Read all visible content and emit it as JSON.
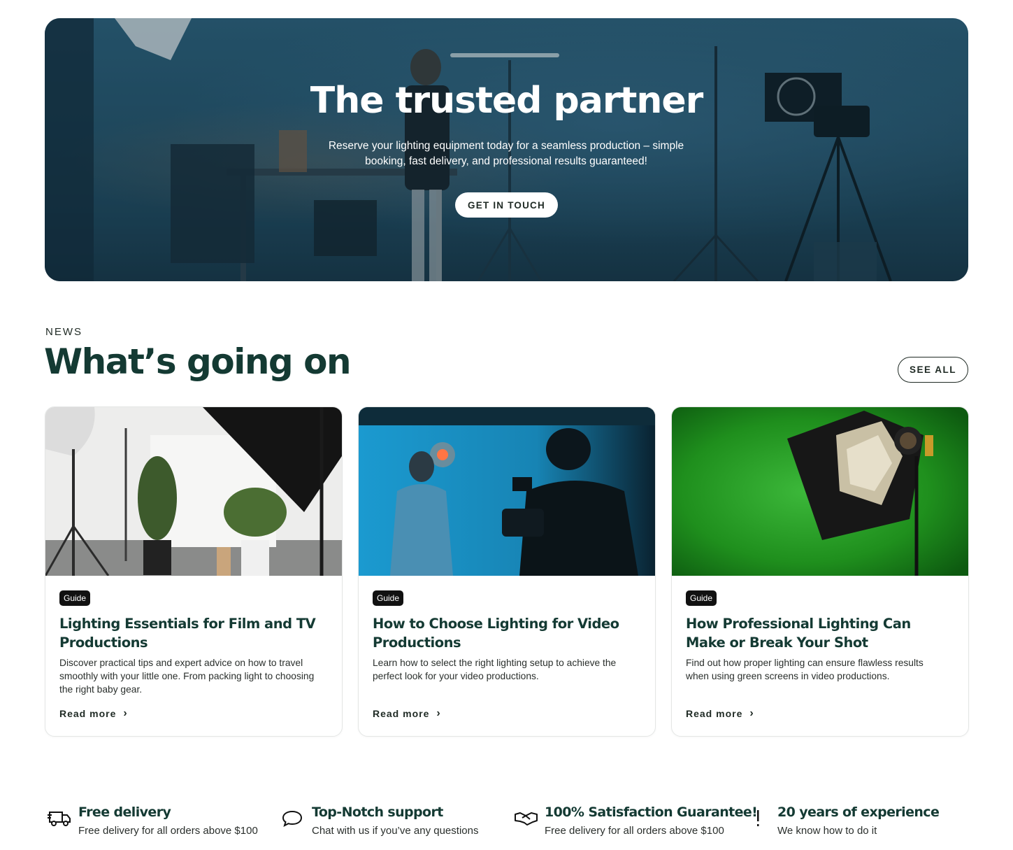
{
  "hero": {
    "title": "The trusted partner",
    "subtitle": "Reserve your lighting equipment today for a seamless production – simple booking, fast delivery, and professional results guaranteed!",
    "cta_label": "GET IN TOUCH"
  },
  "news": {
    "eyebrow": "NEWS",
    "title": "What’s going on",
    "see_all_label": "SEE ALL",
    "cards": [
      {
        "badge": "Guide",
        "title": "Lighting Essentials for Film and TV Productions",
        "description": "Discover practical tips and expert advice on how to travel smoothly with your little one. From packing light to choosing the right baby gear.",
        "read_more": "Read more"
      },
      {
        "badge": "Guide",
        "title": "How to Choose Lighting for Video Productions",
        "description": "Learn how to select the right lighting setup to achieve the perfect look for your video productions.",
        "read_more": "Read more"
      },
      {
        "badge": "Guide",
        "title": "How Professional Lighting Can Make or Break Your Shot",
        "description": "Find out how proper lighting can ensure flawless results when using green screens in video productions.",
        "read_more": "Read more"
      }
    ]
  },
  "features": [
    {
      "icon": "delivery-truck-icon",
      "title": "Free delivery",
      "description": "Free delivery for all orders above $100"
    },
    {
      "icon": "chat-bubble-icon",
      "title": "Top-Notch support",
      "description": "Chat with us if you’ve any questions"
    },
    {
      "icon": "handshake-icon",
      "title": "100% Satisfaction Guarantee!",
      "description": "Free delivery for all orders above $100"
    },
    {
      "icon": "exclamation-icon",
      "title": "20 years of experience",
      "description": "We know how to do it"
    }
  ],
  "colors": {
    "heading": "#143a33",
    "hero_bg": "#224d63",
    "badge_bg": "#111111"
  }
}
